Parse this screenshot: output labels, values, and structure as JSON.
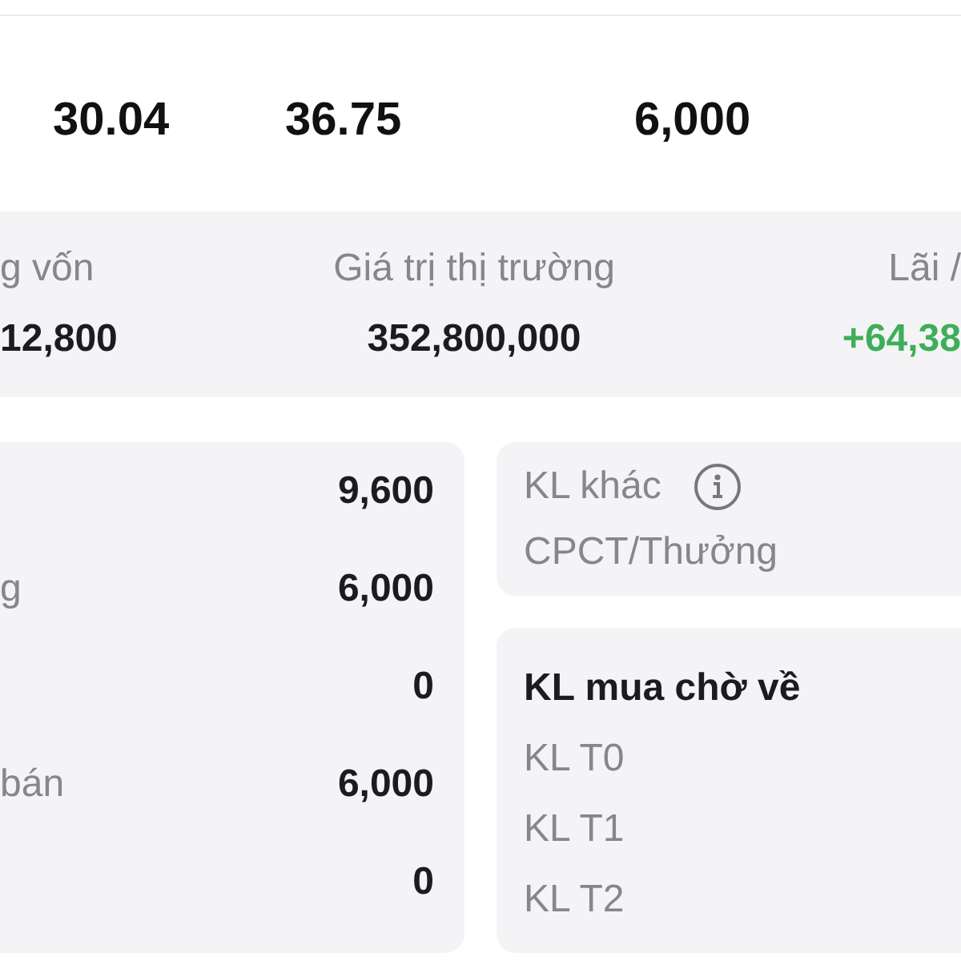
{
  "summary": {
    "values": [
      "30.04",
      "36.75",
      "6,000"
    ]
  },
  "stats": [
    {
      "label": "g vốn",
      "value": "12,800",
      "color": "#1c1c1e"
    },
    {
      "label": "Giá trị thị trường",
      "value": "352,800,000",
      "color": "#1c1c1e"
    },
    {
      "label": "Lãi /",
      "value": "+64,38",
      "color": "#3fae5a"
    }
  ],
  "quantities": [
    {
      "value": "9,600"
    },
    {
      "label": "g",
      "value": "6,000"
    },
    {
      "value": "0"
    },
    {
      "label": "bán",
      "value": "6,000"
    },
    {
      "value": "0"
    }
  ],
  "other_volume": {
    "title": "KL khác",
    "items": [
      "CPCT/Thưởng"
    ]
  },
  "pending_buy": {
    "title": "KL mua chờ về",
    "items": [
      "KL T0",
      "KL T1",
      "KL T2"
    ]
  }
}
